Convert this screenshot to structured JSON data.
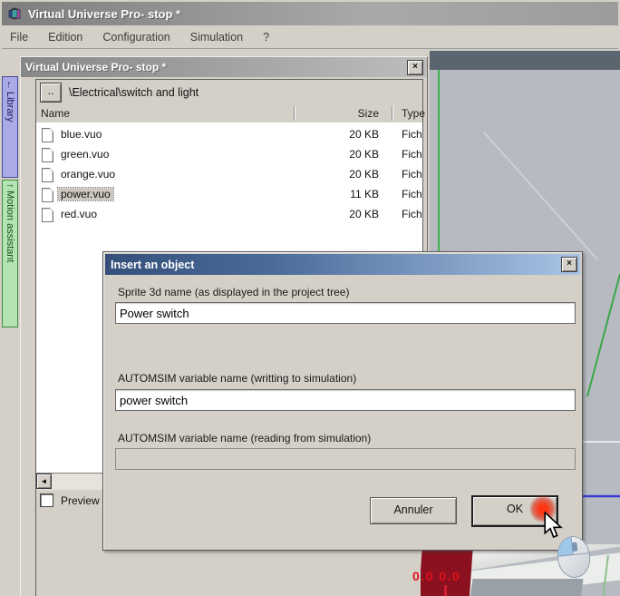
{
  "window": {
    "title": "Virtual Universe Pro- stop *",
    "menu": {
      "file": "File",
      "edition": "Edition",
      "configuration": "Configuration",
      "simulation": "Simulation",
      "help": "?"
    }
  },
  "sidebar": {
    "tabs": [
      {
        "arrow": "←",
        "label": "Library"
      },
      {
        "arrow": "↑",
        "label": "Motion assistant"
      }
    ]
  },
  "panel": {
    "title": "Virtual Universe Pro- stop *",
    "close_icon": "×",
    "up_button": "..",
    "path": "\\Electrical\\switch and light",
    "columns": {
      "name": "Name",
      "size": "Size",
      "type": "Type"
    },
    "files": [
      {
        "name": "blue.vuo",
        "size": "20 KB",
        "type": "Fichi"
      },
      {
        "name": "green.vuo",
        "size": "20 KB",
        "type": "Fichi"
      },
      {
        "name": "orange.vuo",
        "size": "20 KB",
        "type": "Fichi"
      },
      {
        "name": "power.vuo",
        "size": "11 KB",
        "type": "Fichi"
      },
      {
        "name": "red.vuo",
        "size": "20 KB",
        "type": "Fichi"
      }
    ],
    "scroll_left_arrow": "◄",
    "preview_label": "Preview"
  },
  "dialog": {
    "title": "Insert an object",
    "close_icon": "×",
    "sprite_label": "Sprite 3d name (as displayed in the project tree)",
    "sprite_value": "Power switch",
    "write_label": "AUTOMSIM variable name (writting to simulation)",
    "write_value": "power switch",
    "read_label": "AUTOMSIM variable name (reading from simulation)",
    "read_value": "",
    "cancel_button": "Annuler",
    "ok_button": "OK"
  },
  "viewport": {
    "coords_text": "0.0 0.0",
    "colors": {
      "background": "#b7bbc1",
      "top_strip": "#5b6570",
      "green_axis": "#3cb44a",
      "blue_axis": "#3a3ad6",
      "object_red": "#8c1120",
      "click_glow": "#ff2e0a"
    }
  }
}
